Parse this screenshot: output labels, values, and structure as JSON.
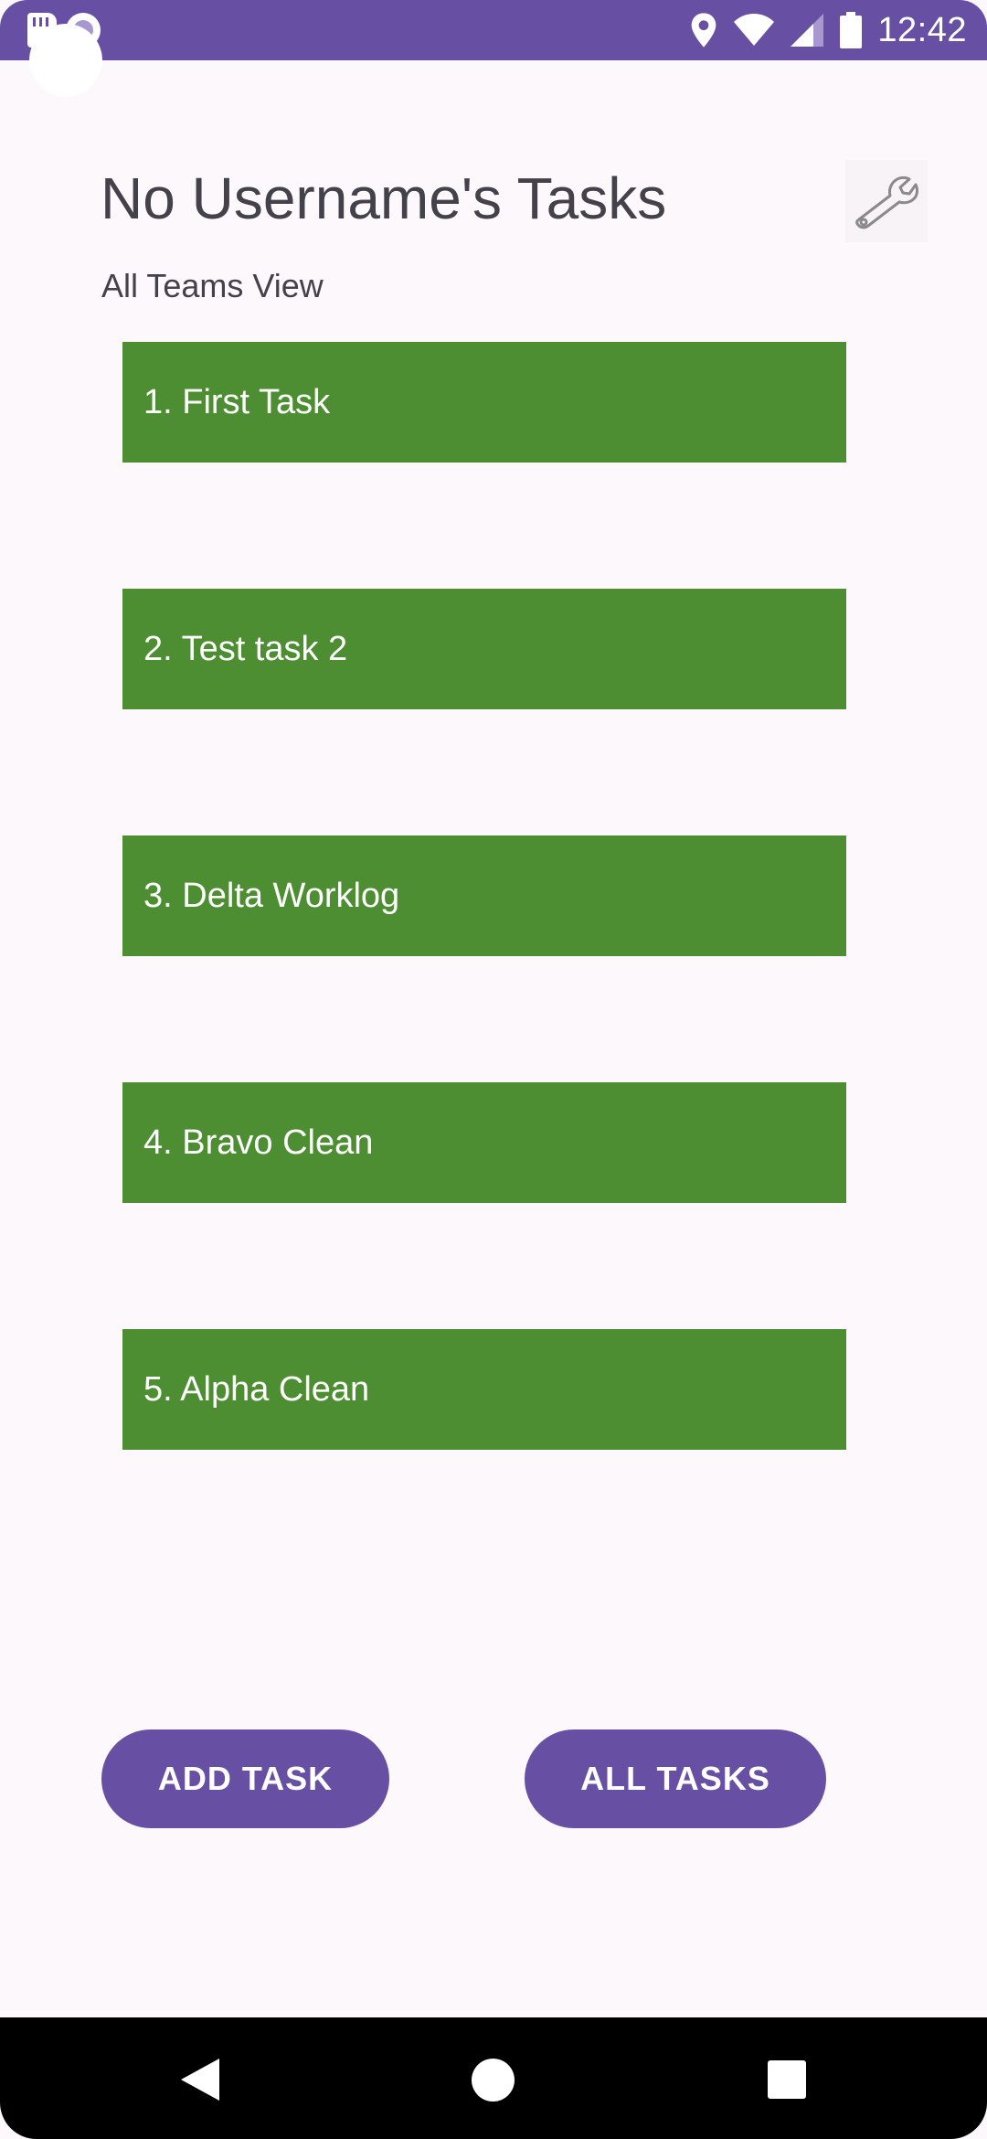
{
  "status_bar": {
    "time": "12:42",
    "icons": [
      "sd-card-icon",
      "record-icon",
      "location-icon",
      "wifi-icon",
      "signal-icon",
      "battery-icon"
    ],
    "background_color": "#6750a4"
  },
  "header": {
    "title": "No Username's Tasks",
    "subtitle": "All Teams View",
    "settings_icon": "wrench-icon"
  },
  "tasks": [
    {
      "label": "1. First Task"
    },
    {
      "label": "2. Test task 2"
    },
    {
      "label": "3. Delta Worklog"
    },
    {
      "label": "4. Bravo Clean"
    },
    {
      "label": "5. Alpha Clean"
    }
  ],
  "task_color": "#4e8e33",
  "buttons": {
    "add_task": "ADD TASK",
    "all_tasks": "ALL TASKS",
    "color": "#6750a4"
  },
  "nav_bar": {
    "icons": [
      "back-icon",
      "home-icon",
      "recents-icon"
    ]
  }
}
